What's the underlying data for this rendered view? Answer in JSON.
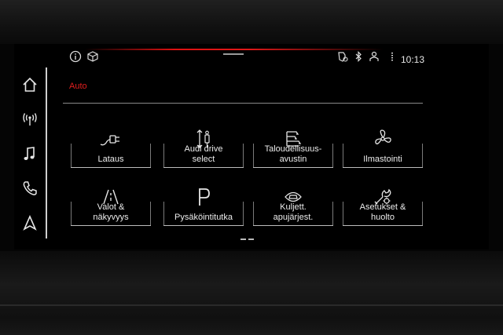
{
  "status_bar": {
    "time": "10:13"
  },
  "page": {
    "title": "Auto"
  },
  "sidebar": {
    "items": [
      {
        "icon": "home-icon"
      },
      {
        "icon": "antenna-icon"
      },
      {
        "icon": "music-note-icon"
      },
      {
        "icon": "phone-icon"
      },
      {
        "icon": "navigation-arrow-icon"
      }
    ]
  },
  "tiles": [
    {
      "label": "Lataus",
      "icon": "charging-plug-icon"
    },
    {
      "label": "Audi drive\nselect",
      "icon": "drive-select-icon"
    },
    {
      "label": "Taloudellisuus-\navustin",
      "icon": "efficiency-icon"
    },
    {
      "label": "Ilmastointi",
      "icon": "fan-icon"
    },
    {
      "label": "Valot &\nnäkyvyys",
      "icon": "road-lights-icon"
    },
    {
      "label": "Pysäköintitutka",
      "icon": "parking-icon"
    },
    {
      "label": "Kuljett.\napujärjest.",
      "icon": "driver-assist-icon"
    },
    {
      "label": "Asetukset &\nhuolto",
      "icon": "settings-service-icon"
    }
  ],
  "colors": {
    "accent": "#e21e1e",
    "text": "#ececec",
    "background": "#000000"
  }
}
